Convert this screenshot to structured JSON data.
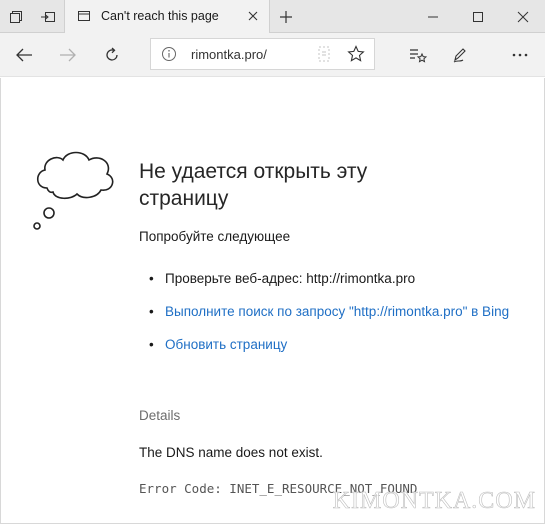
{
  "tab": {
    "title": "Can't reach this page"
  },
  "address_bar": {
    "url": "rimontka.pro/"
  },
  "icons": {
    "tab_manager": "tab-manager-icon",
    "set_aside": "set-aside-tabs-icon",
    "page": "page-icon",
    "close": "close-icon",
    "new_tab": "plus-icon",
    "minimize": "minimize-icon",
    "maximize": "maximize-icon",
    "window_close": "window-close-icon",
    "back": "back-arrow-icon",
    "forward": "forward-arrow-icon",
    "refresh": "refresh-icon",
    "info": "info-icon",
    "reading_view": "reading-view-icon",
    "favorite": "star-icon",
    "hub": "hub-icon",
    "web_note": "pen-icon",
    "more": "more-icon",
    "error_illustration": "thought-cloud-icon"
  },
  "error_page": {
    "heading": "Не удается открыть эту страницу",
    "try_label": "Попробуйте следующее",
    "suggestions": [
      {
        "text": "Проверьте веб-адрес: http://rimontka.pro",
        "is_link": false
      },
      {
        "text": "Выполните поиск по запросу \"http://rimontka.pro\" в Bing",
        "is_link": true
      },
      {
        "text": "Обновить страницу",
        "is_link": true
      }
    ],
    "details_label": "Details",
    "dns_message": "The DNS name does not exist.",
    "error_code": "Error Code: INET_E_RESOURCE_NOT_FOUND"
  },
  "watermark": "KIMONTKA.COM",
  "colors": {
    "link": "#1f6fc5",
    "chrome_bg": "#e6e6e6",
    "toolbar_bg": "#f2f2f2",
    "text": "#1a1a1a",
    "muted": "#6d6d6d"
  }
}
